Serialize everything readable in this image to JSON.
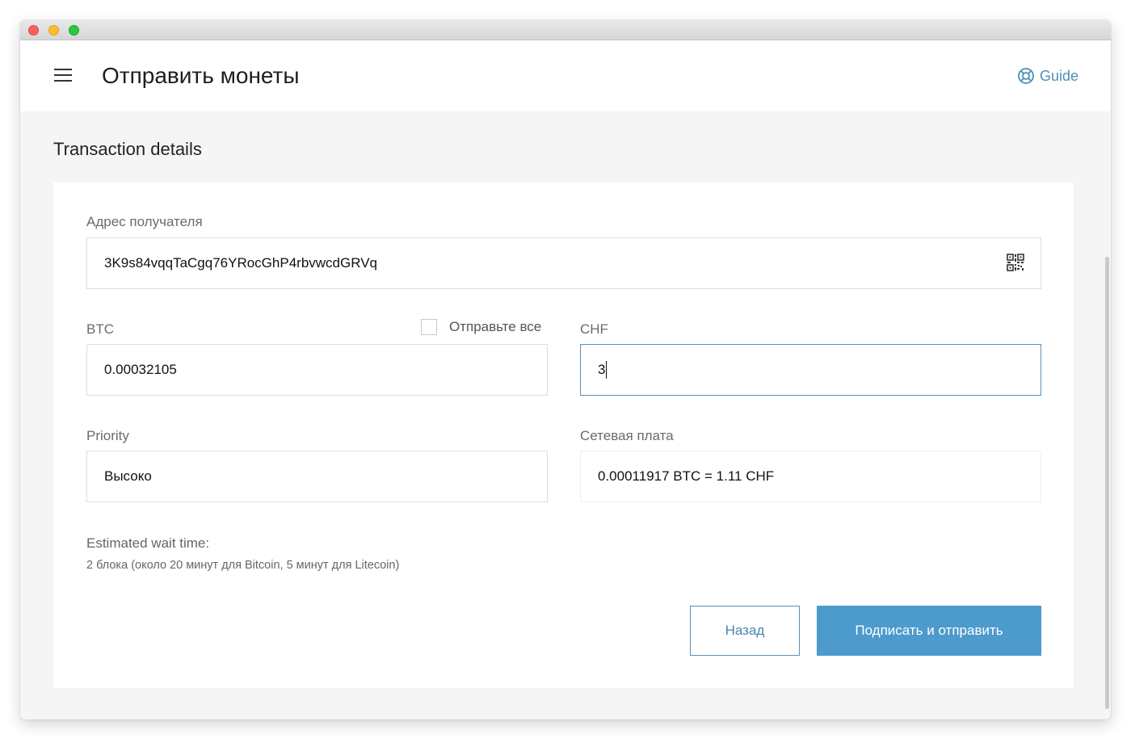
{
  "header": {
    "title": "Отправить монеты",
    "guide_label": "Guide"
  },
  "section_title": "Transaction details",
  "form": {
    "recipient": {
      "label": "Адрес получателя",
      "value": "3K9s84vqqTaCgq76YRocGhP4rbvwcdGRVq"
    },
    "btc": {
      "label": "BTC",
      "value": "0.00032105",
      "send_all_label": "Отправьте все",
      "send_all_checked": false
    },
    "chf": {
      "label": "CHF",
      "value": "3"
    },
    "priority": {
      "label": "Priority",
      "value": "Высоко"
    },
    "fee": {
      "label": "Сетевая плата",
      "value": "0.00011917 BTC = 1.11 CHF"
    },
    "wait": {
      "title": "Estimated wait time:",
      "text": "2 блока (около 20 минут для Bitcoin, 5 минут для Litecoin)"
    }
  },
  "buttons": {
    "back": "Назад",
    "send": "Подписать и отправить"
  },
  "colors": {
    "accent": "#4d9acc",
    "focus_border": "#5a8fb6",
    "link": "#4a90b8"
  },
  "icons": {
    "menu": "hamburger-icon",
    "guide": "lifebuoy-icon",
    "qr": "qr-code-icon"
  }
}
